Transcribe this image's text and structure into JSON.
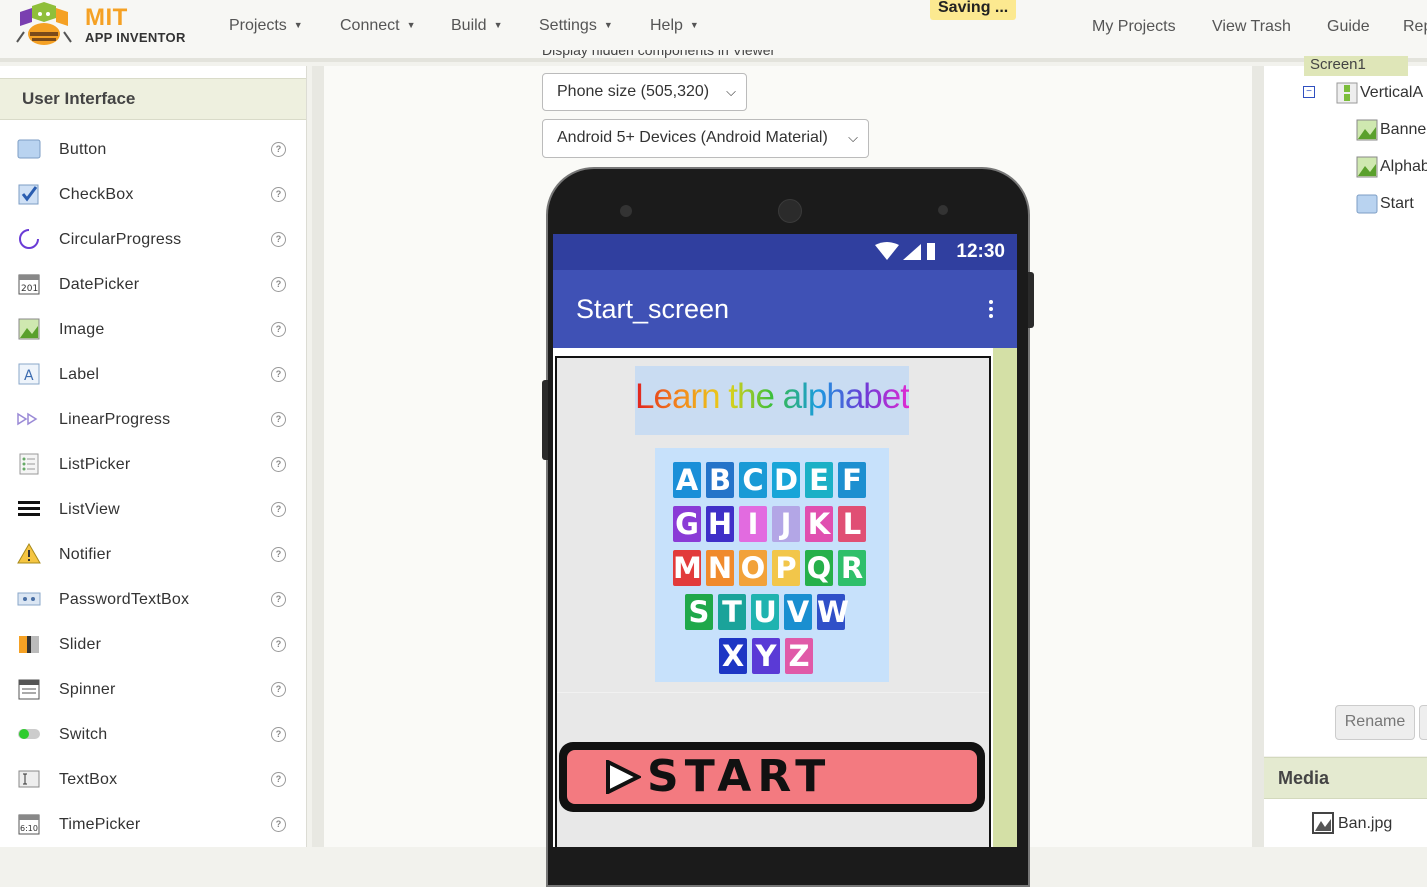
{
  "header": {
    "logo_title": "MIT",
    "logo_subtitle": "APP INVENTOR",
    "menus": [
      "Projects",
      "Connect",
      "Build",
      "Settings",
      "Help"
    ],
    "right_links": [
      "My Projects",
      "View Trash",
      "Guide",
      "Rep"
    ],
    "status": "Saving ..."
  },
  "palette": {
    "title": "User Interface",
    "items": [
      {
        "label": "Button",
        "icon": "button-icon"
      },
      {
        "label": "CheckBox",
        "icon": "checkbox-icon"
      },
      {
        "label": "CircularProgress",
        "icon": "circular-progress-icon"
      },
      {
        "label": "DatePicker",
        "icon": "datepicker-icon"
      },
      {
        "label": "Image",
        "icon": "image-icon"
      },
      {
        "label": "Label",
        "icon": "label-icon"
      },
      {
        "label": "LinearProgress",
        "icon": "linear-progress-icon"
      },
      {
        "label": "ListPicker",
        "icon": "listpicker-icon"
      },
      {
        "label": "ListView",
        "icon": "listview-icon"
      },
      {
        "label": "Notifier",
        "icon": "notifier-icon"
      },
      {
        "label": "PasswordTextBox",
        "icon": "password-textbox-icon"
      },
      {
        "label": "Slider",
        "icon": "slider-icon"
      },
      {
        "label": "Spinner",
        "icon": "spinner-icon"
      },
      {
        "label": "Switch",
        "icon": "switch-icon"
      },
      {
        "label": "TextBox",
        "icon": "textbox-icon"
      },
      {
        "label": "TimePicker",
        "icon": "timepicker-icon"
      }
    ],
    "help_glyph": "?"
  },
  "viewer": {
    "hidden_components_label": "Display hidden components in Viewer",
    "phone_size": "Phone size (505,320)",
    "theme": "Android 5+ Devices (Android Material)",
    "status_time": "12:30",
    "app_title": "Start_screen",
    "banner_text": "Learn the alphabet",
    "alphabet_letters": [
      "A",
      "B",
      "C",
      "D",
      "E",
      "F",
      "G",
      "H",
      "I",
      "J",
      "K",
      "L",
      "M",
      "N",
      "O",
      "P",
      "Q",
      "R",
      "S",
      "T",
      "U",
      "V",
      "W",
      "X",
      "Y",
      "Z"
    ],
    "start_text": "START"
  },
  "components_tree": {
    "screen": "Screen1",
    "items": [
      {
        "label": "VerticalA",
        "icon": "vertical-arrangement-icon"
      },
      {
        "label": "Banne",
        "icon": "image-icon"
      },
      {
        "label": "Alphab",
        "icon": "image-icon"
      },
      {
        "label": "Start",
        "icon": "button-icon"
      }
    ],
    "rename_label": "Rename"
  },
  "media": {
    "title": "Media",
    "files": [
      "Ban.jpg"
    ]
  },
  "colors": {
    "accent_orange": "#f5a124",
    "status_bar": "#303f9f",
    "app_bar": "#3f51b5",
    "panel_header": "#eef0df",
    "saving_bg": "#fce990"
  }
}
